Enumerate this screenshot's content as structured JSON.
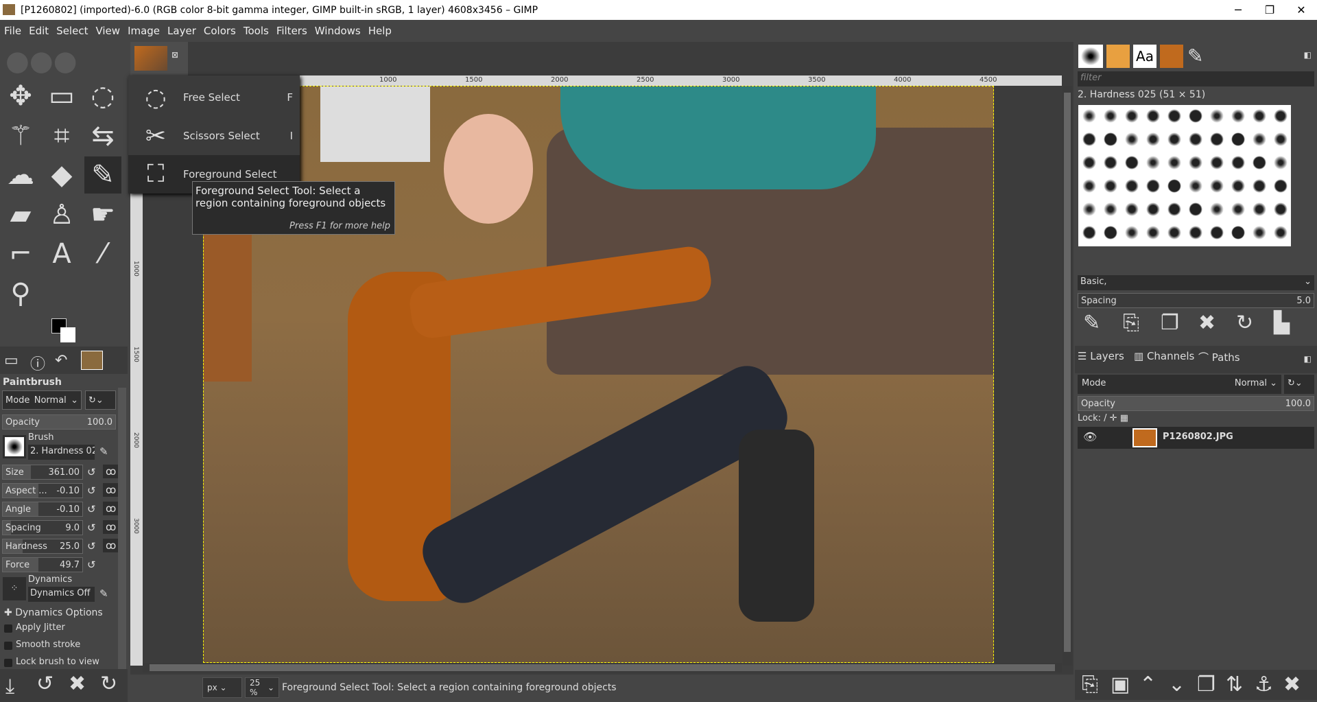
{
  "window": {
    "title": "[P1260802] (imported)-6.0 (RGB color 8-bit gamma integer, GIMP built-in sRGB, 1 layer) 4608x3456 – GIMP",
    "minimize": "─",
    "restore": "❐",
    "close": "✕"
  },
  "menu": [
    "File",
    "Edit",
    "Select",
    "View",
    "Image",
    "Layer",
    "Colors",
    "Tools",
    "Filters",
    "Windows",
    "Help"
  ],
  "tools": [
    "move-icon",
    "rect-select-icon",
    "lasso-icon",
    "fuzzy-select-icon",
    "crop-icon",
    "flip-icon",
    "warp-icon",
    "bucket-fill-icon",
    "paintbrush-icon",
    "eraser-icon",
    "clone-icon",
    "smudge-icon",
    "paths-icon",
    "text-icon",
    "color-picker-icon",
    "zoom-icon"
  ],
  "flyout": [
    {
      "label": "Free Select",
      "key": "F",
      "icon": "free-select-icon"
    },
    {
      "label": "Scissors Select",
      "key": "I",
      "icon": "scissors-icon"
    },
    {
      "label": "Foreground Select",
      "key": "",
      "icon": "foreground-select-icon"
    }
  ],
  "tooltip": {
    "text": "Foreground Select Tool: Select a region containing foreground objects",
    "help": "Press F1 for more help"
  },
  "ruler": {
    "top": [
      "1000",
      "1500",
      "2000",
      "2500",
      "3000",
      "3500",
      "4000",
      "4500"
    ],
    "left": [
      "1000",
      "1500",
      "2000",
      "3000"
    ]
  },
  "tool_options": {
    "title": "Paintbrush",
    "mode_label": "Mode",
    "mode": "Normal",
    "opacity_label": "Opacity",
    "opacity": "100.0",
    "brush_label": "Brush",
    "brush": "2. Hardness 02",
    "params": [
      {
        "label": "Size",
        "value": "361.00",
        "fill": 0.35
      },
      {
        "label": "Aspect ...",
        "value": "-0.10",
        "fill": 0.45
      },
      {
        "label": "Angle",
        "value": "-0.10",
        "fill": 0.45
      },
      {
        "label": "Spacing",
        "value": "9.0",
        "fill": 0.1
      },
      {
        "label": "Hardness",
        "value": "25.0",
        "fill": 0.25
      },
      {
        "label": "Force",
        "value": "49.7",
        "fill": 0.45
      }
    ],
    "dynamics_label": "Dynamics",
    "dynamics": "Dynamics Off",
    "dynamics_options": "Dynamics Options",
    "checks": [
      "Apply Jitter",
      "Smooth stroke",
      "Lock brush to view"
    ]
  },
  "status": {
    "unit": "px",
    "zoom": "25 %",
    "message": "Foreground Select Tool: Select a region containing foreground objects"
  },
  "brushes": {
    "filter_placeholder": "filter",
    "selected": "2. Hardness 025 (51 × 51)",
    "tag": "Basic,",
    "spacing_label": "Spacing",
    "spacing": "5.0"
  },
  "layers": {
    "tabs": [
      "Layers",
      "Channels",
      "Paths"
    ],
    "mode_label": "Mode",
    "mode": "Normal",
    "opacity_label": "Opacity",
    "opacity": "100.0",
    "lock_label": "Lock:",
    "items": [
      {
        "name": "P1260802.JPG",
        "visible": true
      }
    ]
  }
}
